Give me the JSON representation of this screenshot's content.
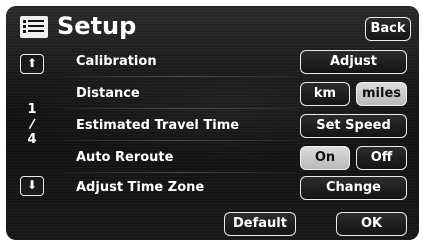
{
  "header": {
    "title": "Setup",
    "icon": "menu-list-icon",
    "back_label": "Back"
  },
  "pager": {
    "up_icon": "up-arrow-icon",
    "down_icon": "down-arrow-icon",
    "up_glyph": "⬆",
    "down_glyph": "⬇",
    "current": "1",
    "slash": "/",
    "total": "4"
  },
  "settings": [
    {
      "label": "Calibration",
      "buttons": [
        "Adjust"
      ]
    },
    {
      "label": "Distance",
      "buttons": [
        "km",
        "miles"
      ],
      "selected": "miles"
    },
    {
      "label": "Estimated Travel Time",
      "buttons": [
        "Set Speed"
      ]
    },
    {
      "label": "Auto Reroute",
      "buttons": [
        "On",
        "Off"
      ],
      "selected": "On"
    },
    {
      "label": "Adjust Time Zone",
      "buttons": [
        "Change"
      ]
    }
  ],
  "footer": {
    "default_label": "Default",
    "ok_label": "OK"
  },
  "colors": {
    "background": "#111111",
    "text": "#ffffff",
    "button_border": "#eaeaea",
    "selected_fill": "#c8c8c8"
  }
}
